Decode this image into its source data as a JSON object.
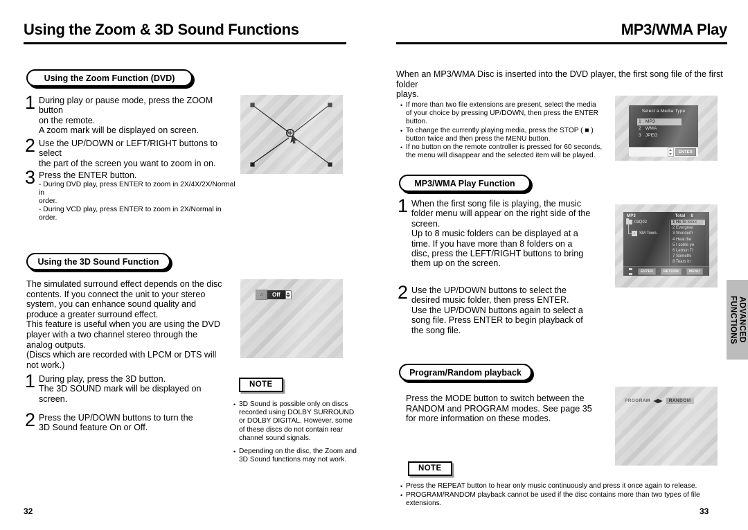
{
  "left_page": {
    "title": "Using the Zoom & 3D Sound Functions",
    "folio": "32",
    "zoom_section": {
      "banner": "Using the Zoom Function (DVD)",
      "steps": [
        {
          "num": "1",
          "lines": [
            "During play or pause mode, press the ZOOM button",
            "on the remote.",
            "A zoom mark will be displayed on screen."
          ]
        },
        {
          "num": "2",
          "lines": [
            "Use the UP/DOWN or LEFT/RIGHT buttons to select",
            "the part of the screen you want to zoom in on."
          ]
        },
        {
          "num": "3",
          "lines": [
            "Press the ENTER button."
          ],
          "sub": [
            "- During DVD play, press ENTER to zoom in 2X/4X/2X/Normal in",
            "order.",
            "- During VCD play, press ENTER to zoom in 2X/Normal in order."
          ]
        }
      ]
    },
    "sound3d_section": {
      "banner": "Using the 3D Sound Function",
      "intro": [
        "The simulated surround effect depends on the disc",
        "contents. If you connect the unit to your stereo",
        "system, you can enhance sound quality and",
        "produce a greater surround effect.",
        "This feature is useful when you are using the DVD",
        "player with a two channel stereo through the",
        "analog outputs.",
        "(Discs which are recorded with LPCM or DTS will",
        "not work.)"
      ],
      "steps": [
        {
          "num": "1",
          "lines": [
            "During play, press the 3D button.",
            "The 3D SOUND mark will be displayed on",
            "screen."
          ]
        },
        {
          "num": "2",
          "lines": [
            "Press the UP/DOWN buttons to turn the",
            "3D Sound feature On or Off."
          ]
        }
      ],
      "osd": {
        "icon": "speaker-icon",
        "value": "Off",
        "updown": "up-down-arrows-icon"
      }
    },
    "note": {
      "label": "NOTE",
      "bullets": [
        [
          "3D Sound is possible only on discs",
          "recorded using DOLBY SURROUND",
          "or DOLBY DIGITAL. However, some",
          "of these discs do not contain rear",
          "channel sound signals."
        ],
        [
          "Depending on the disc, the Zoom and",
          "3D Sound functions may not work."
        ]
      ]
    }
  },
  "right_page": {
    "title": "MP3/WMA Play",
    "folio": "33",
    "intro": [
      "When an MP3/WMA Disc is inserted into the DVD player, the first song file of the first folder",
      "plays."
    ],
    "intro_bullets": [
      [
        "If more than two file extensions are present, select the media",
        "of your choice by pressing UP/DOWN, then press the ENTER",
        "button."
      ],
      [
        "To change the currently playing media, press the STOP ( ■ )",
        "button twice and then press the MENU button."
      ],
      [
        "If no button on the remote controller is pressed for 60 seconds,",
        "the menu will disappear and the selected item will be played."
      ]
    ],
    "media_osd": {
      "title": "Select a Media Type",
      "items": [
        {
          "num": "1",
          "label": "MP3",
          "selected": true
        },
        {
          "num": "2",
          "label": "WMA",
          "selected": false
        },
        {
          "num": "3",
          "label": "JPEG",
          "selected": false
        }
      ],
      "enter_key": "ENTER"
    },
    "play_section": {
      "banner": "MP3/WMA Play Function",
      "steps": [
        {
          "num": "1",
          "lines": [
            "When the first song file is playing, the music",
            "folder menu will appear on the right side of the",
            "screen.",
            "Up to 8 music folders can be displayed at a",
            "time. If you have more than 8 folders on a",
            "disc, press the LEFT/RIGHT buttons to bring",
            "them up on the screen."
          ]
        },
        {
          "num": "2",
          "lines": [
            "Use the UP/DOWN buttons to select the",
            "desired music folder, then press ENTER.",
            "Use the UP/DOWN buttons again to select a",
            "song file. Press ENTER to begin playback of",
            "the song file."
          ]
        }
      ]
    },
    "mp3_osd": {
      "mode": "MP3",
      "total_label": "Total",
      "total_value": "8",
      "folder": "03Q02",
      "subfolder": "SM Town-",
      "note_icon": "music-note-icon",
      "tracks": [
        {
          "num": "1",
          "label": "He to xxxx",
          "selected": true
        },
        {
          "num": "2",
          "label": "Evergree",
          "selected": false
        },
        {
          "num": "3",
          "label": "Wonderfr",
          "selected": false
        },
        {
          "num": "4",
          "label": "Heal the",
          "selected": false
        },
        {
          "num": "5",
          "label": "I come yo",
          "selected": false
        },
        {
          "num": "6",
          "label": "Lemon Tr",
          "selected": false
        },
        {
          "num": "7",
          "label": "Somethi",
          "selected": false
        },
        {
          "num": "8",
          "label": "Tears in",
          "selected": false
        }
      ],
      "keys": [
        "ENTER",
        "RETURN",
        "MENU"
      ]
    },
    "program_section": {
      "banner": "Program/Random playback",
      "lines": [
        "Press the MODE button to switch between the",
        "RANDOM and PROGRAM modes. See page 35",
        "for more information on these modes."
      ],
      "osd": {
        "left_label": "PROGRAM",
        "right_label": "RANDOM",
        "selected": "RANDOM"
      }
    },
    "note": {
      "label": "NOTE",
      "bullets": [
        "Press the REPEAT button to hear only music continuously and press it once again to release.",
        "PROGRAM/RANDOM playback cannot be used if the disc contains more than two types of file extensions."
      ]
    },
    "side_tab": "ADVANCED\nFUNCTIONS"
  }
}
